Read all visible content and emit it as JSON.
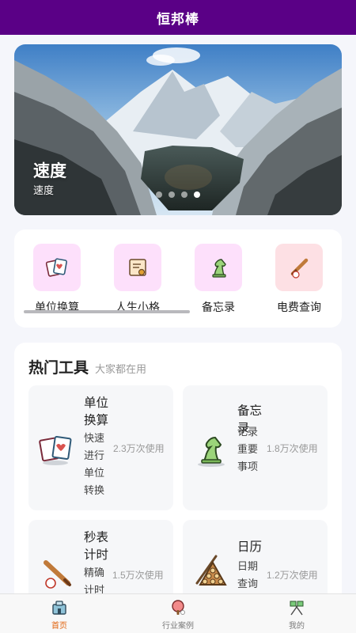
{
  "header": {
    "title": "恒邦棒"
  },
  "banner": {
    "title": "速度",
    "subtitle": "速度",
    "slide_count": 4,
    "active_slide": 4
  },
  "quick_tools": [
    {
      "label": "单位换算",
      "icon": "playing-cards-icon",
      "bg": "#fde0fb"
    },
    {
      "label": "人生小格",
      "icon": "certificate-scroll-icon",
      "bg": "#fde0fb"
    },
    {
      "label": "备忘录",
      "icon": "chess-knight-icon",
      "bg": "#fde0fb"
    },
    {
      "label": "电费查询",
      "icon": "baseball-bat-icon",
      "bg": "#fde0e4"
    }
  ],
  "hot": {
    "title": "热门工具",
    "subtitle": "大家都在用",
    "tools": [
      {
        "name": "单位换算",
        "desc": "快速进行单位转换",
        "uses": "2.3万次使用",
        "icon": "playing-cards-icon"
      },
      {
        "name": "备忘录",
        "desc": "记录重要事项",
        "uses": "1.8万次使用",
        "icon": "chess-knight-icon"
      },
      {
        "name": "秒表计时",
        "desc": "精确计时",
        "uses": "1.5万次使用",
        "icon": "baseball-bat-icon"
      },
      {
        "name": "日历",
        "desc": "日期查询",
        "uses": "1.2万次使用",
        "icon": "billiards-rack-icon"
      }
    ]
  },
  "tabbar": {
    "items": [
      {
        "label": "首页",
        "icon": "home-icon",
        "active": true
      },
      {
        "label": "行业案例",
        "icon": "ping-pong-icon",
        "active": false
      },
      {
        "label": "我的",
        "icon": "crossed-flags-icon",
        "active": false
      }
    ],
    "active_color": "#e0620d"
  },
  "colors": {
    "header_bg": "#5a0086",
    "page_bg": "#f5f6fb"
  }
}
